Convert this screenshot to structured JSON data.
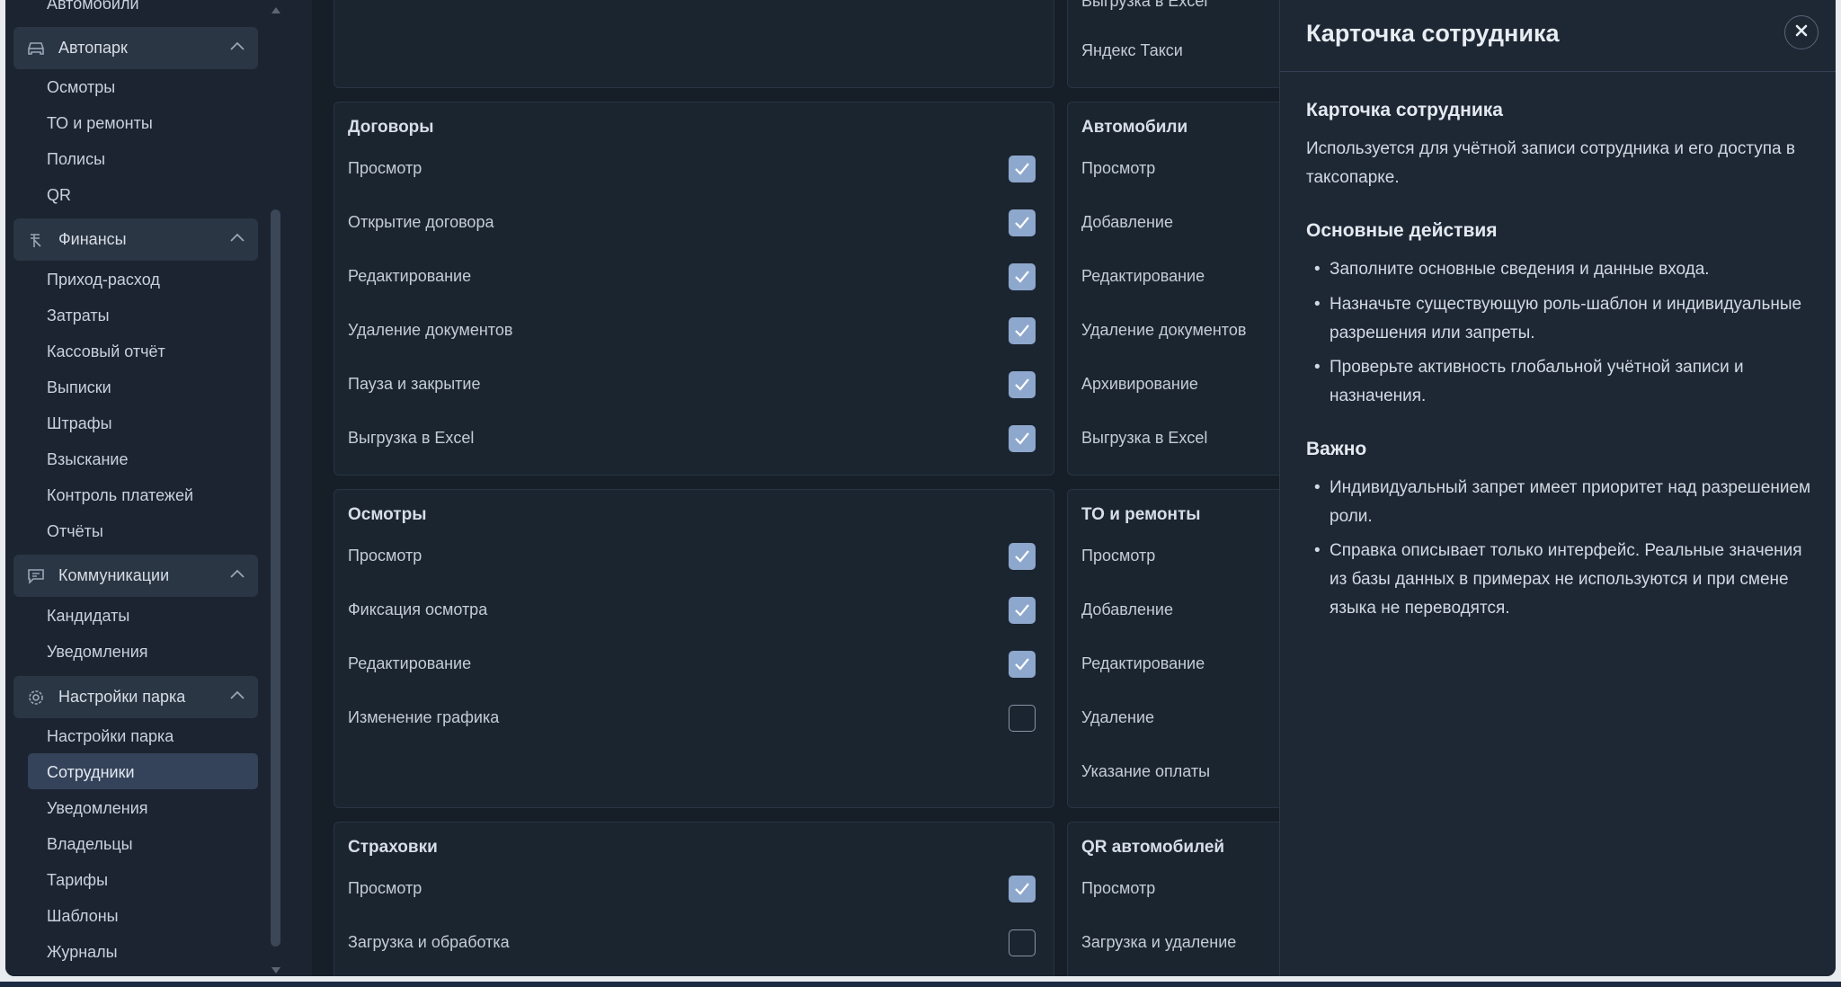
{
  "sidebar": {
    "top_partial": "Автомобили",
    "groups": [
      {
        "label": "Автопарк",
        "items": [
          "Осмотры",
          "ТО и ремонты",
          "Полисы",
          "QR"
        ]
      },
      {
        "label": "Финансы",
        "items": [
          "Приход-расход",
          "Затраты",
          "Кассовый отчёт",
          "Выписки",
          "Штрафы",
          "Взыскание",
          "Контроль платежей",
          "Отчёты"
        ]
      },
      {
        "label": "Коммуникации",
        "items": [
          "Кандидаты",
          "Уведомления"
        ]
      },
      {
        "label": "Настройки парка",
        "items": [
          "Настройки парка",
          "Сотрудники",
          "Уведомления",
          "Владельцы",
          "Тарифы",
          "Шаблоны",
          "Журналы"
        ]
      }
    ],
    "active_item": "Сотрудники"
  },
  "main": {
    "right_top_partial": "Выгрузка в Excel",
    "right_top_item": "Яндекс Такси",
    "left_cards": [
      {
        "title": "Договоры",
        "rows": [
          {
            "label": "Просмотр",
            "checked": true
          },
          {
            "label": "Открытие договора",
            "checked": true
          },
          {
            "label": "Редактирование",
            "checked": true
          },
          {
            "label": "Удаление документов",
            "checked": true
          },
          {
            "label": "Пауза и закрытие",
            "checked": true
          },
          {
            "label": "Выгрузка в Excel",
            "checked": true
          }
        ]
      },
      {
        "title": "Осмотры",
        "rows": [
          {
            "label": "Просмотр",
            "checked": true
          },
          {
            "label": "Фиксация осмотра",
            "checked": true
          },
          {
            "label": "Редактирование",
            "checked": true
          },
          {
            "label": "Изменение графика",
            "checked": false
          }
        ]
      },
      {
        "title": "Страховки",
        "rows": [
          {
            "label": "Просмотр",
            "checked": true
          },
          {
            "label": "Загрузка и обработка",
            "checked": false
          }
        ]
      }
    ],
    "right_cards": [
      {
        "title": "Автомобили",
        "rows": [
          "Просмотр",
          "Добавление",
          "Редактирование",
          "Удаление документов",
          "Архивирование",
          "Выгрузка в Excel"
        ]
      },
      {
        "title": "ТО и ремонты",
        "rows": [
          "Просмотр",
          "Добавление",
          "Редактирование",
          "Удаление",
          "Указание оплаты"
        ]
      },
      {
        "title": "QR автомобилей",
        "rows": [
          "Просмотр",
          "Загрузка и удаление"
        ]
      }
    ]
  },
  "panel": {
    "header_title": "Карточка сотрудника",
    "close_icon": "close-icon",
    "section1_title": "Карточка сотрудника",
    "section1_text": "Используется для учётной записи сотрудника и его доступа в таксопарке.",
    "section2_title": "Основные действия",
    "section2_bullets": [
      "Заполните основные сведения и данные входа.",
      "Назначьте существующую роль-шаблон и индивидуальные разрешения или запреты.",
      "Проверьте активность глобальной учётной записи и назначения."
    ],
    "section3_title": "Важно",
    "section3_bullets": [
      "Индивидуальный запрет имеет приоритет над разрешением роли.",
      "Справка описывает только интерфейс. Реальные значения из базы данных в примерах не используются и при смене языка не переводятся."
    ]
  },
  "colors": {
    "checkbox_checked": "#8ea7cc",
    "sidebar_bg": "#1b2430",
    "main_bg": "#161e28",
    "panel_bg": "#1e2835"
  }
}
